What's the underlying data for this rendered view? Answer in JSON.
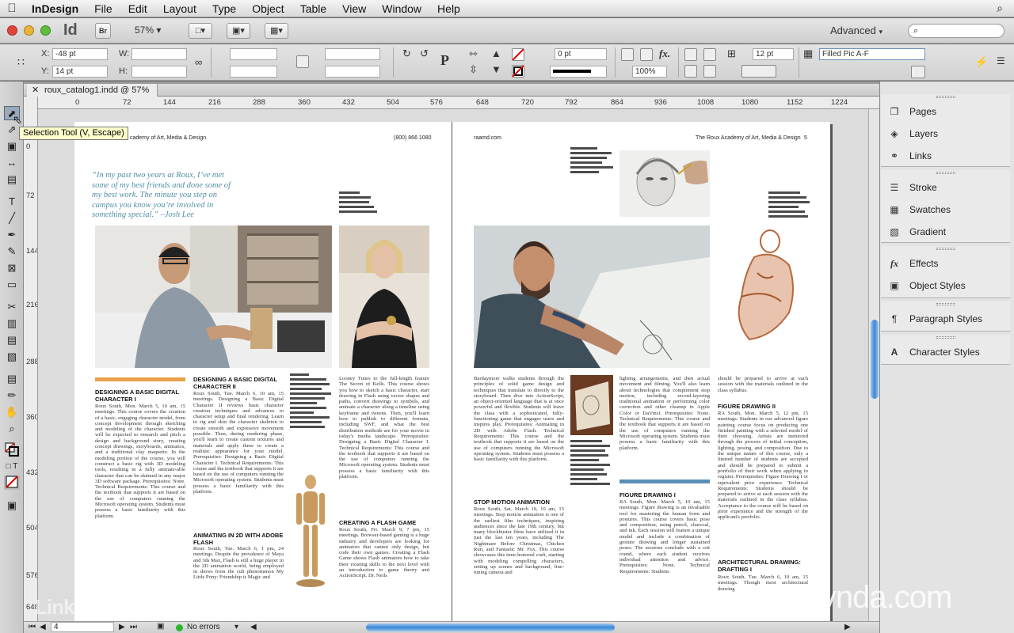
{
  "menubar": {
    "app": "InDesign",
    "items": [
      "File",
      "Edit",
      "Layout",
      "Type",
      "Object",
      "Table",
      "View",
      "Window",
      "Help"
    ]
  },
  "appbar": {
    "logo": "Id",
    "bridge": "Br",
    "zoom": "57%",
    "workspace": "Advanced"
  },
  "control": {
    "x_value": "-48 pt",
    "y_value": "14 pt",
    "stroke_weight": "0 pt",
    "opacity": "100%",
    "gap": "12 pt",
    "object_style": "Filled Pic A-F"
  },
  "tabs": {
    "doc_title": "roux_catalog1.indd @ 57%"
  },
  "tooltip": "Selection Tool (V, Escape)",
  "rulers": {
    "h": [
      "0",
      "72",
      "144",
      "216",
      "288",
      "360",
      "432",
      "504",
      "576",
      "648",
      "720",
      "792",
      "864",
      "936",
      "1008",
      "1080",
      "1152",
      "1224"
    ],
    "v": [
      "0",
      "72",
      "144",
      "216",
      "288",
      "360",
      "432",
      "504",
      "576",
      "648"
    ]
  },
  "spread": {
    "left_header": "cademy of Art, Media & Design",
    "left_phone": "(800) 866 1080",
    "right_url": "raamd.com",
    "right_header": "The Roux Academy of Art, Media & Design",
    "right_page_num": "5",
    "quote": "“In my past two years at Roux, I’ve met some of my best friends and done some of my best work. The minute you step on campus you know you’re involved in something special.” –Josh Lee",
    "course1_title": "DESIGNING A BASIC DIGITAL CHARACTER I",
    "course1_body": "Roux South, Mon. March 5, 10 am, 15 meetings. This course covers the creation of a basic, engaging character model, from concept development through sketching and modeling of the character. Students will be expected to research and pitch a design and background story, creating concept drawings, storyboards, animatics, and a traditional clay maquette. In the modeling portion of the course, you will construct a basic rig with 3D modeling tools, resulting in a fully animate-able character that can be skinned in any major 3D software package. Prerequisites: None. Technical Requirements: This course and the textbook that supports it are based on the use of computers running the Microsoft operating system. Students must possess a basic familiarity with this platform.",
    "course2_title": "DESIGNING A BASIC DIGITAL CHARACTER II",
    "course2_body": "Roux South, Tue. March 6, 10 am, 15 meetings. Designing a Basic Digital Character II reviews basic character creation techniques and advances to character setup and final rendering. Learn to rig and skin the character skeleton to create smooth and expressive movement possible. Then, during rendering phase, you'll learn to create custom textures and materials and apply these to create a realistic appearance for your model. Prerequisites: Designing a Basic Digital Character I. Technical Requirements: This course and the textbook that supports it are based on the use of computers running the Microsoft operating system. Students must possess a basic familiarity with this platform.",
    "course3_title": "ANIMATING IN 2D WITH ADOBE FLASH",
    "course3_body": "Roux South, Tue. March 6, 1 pm, 24 meetings. Despite the prevalence of Maya and 3ds Max, Flash is still a huge player in the 2D animation world, being employed in shows from the cult phenomenon My Little Pony: Friendship is Magic and",
    "col4_body": "Looney Tunes to the full-length feature The Secret of Kells. This course shows you how to sketch a basic character, start drawing in Flash using vector shapes and paths, convert drawings to symbols, and animate a character along a timeline using keyframe and tweens. Then, you'll learn how to publish to different formats, including SWF, and what the best distribution methods are for your movie in today's media landscape. Prerequisites: Designing a Basic Digital Character I. Technical Requirements: This course and the textbook that supports it are based on the use of computers running the Microsoft operating system. Students must possess a basic familiarity with this platform.",
    "course4_title": "CREATING A FLASH GAME",
    "course4_body": "Roux South, Fri. March 9, 7 pm, 15 meetings. Browser-based gaming is a huge industry and developers are looking for animators that cannot only design, but code their own games. Creating a Flash Game shows Flash animators how to take their existing skills to the next level with an introduction to game theory and ActionScript. Dr. Neils",
    "col5_body": "Bardaymore walks students through the principles of solid game design and techniques that translate to directly to the storyboard. Then dive into ActionScript, an object-oriented language that is at once powerful and flexible. Students will leave the class with a sophisticated, fully-functioning game that engages users and inspires play. Prerequisites: Animating in 2D with Adobe Flash. Technical Requirements: This course and the textbook that supports it are based on the use of computers running the Microsoft operating system. Students must possess a basic familiarity with this platform.",
    "course5_title": "STOP MOTION ANIMATION",
    "course5_body": "Roux South, Sat. March 10, 10 am, 15 meetings. Stop motion animation is one of the earliest film techniques, inspiring audiences since the late 19th century, but many blockbuster films have utilized it in just the last ten years, including The Nightmare Before Christmas, Chicken Run, and Fantastic Mr. Fox. This course showcases this time-honored craft, starting with modeling compelling characters, setting up scenes and background, fine-tuning camera and",
    "col6_body": "lighting arrangements, and then actual movement and filming. You'll also learn about technologies that complement stop motion, including record-layering traditional animation or performing color correction and other cleanup in Apple Color or DaVinci. Prerequisites: None. Technical Requirements: This course and the textbook that supports it are based on the use of computers running the Microsoft operating system. Students must possess a basic familiarity with this platform.",
    "course6_title": "FIGURE DRAWING I",
    "course6_body": "RA South, Mon. March 5, 10 am, 15 meetings. Figure drawing is an invaluable tool for mastering the human form and postures. This course covers basic pose and composition, using pencil, charcoal, and ink. Each session will feature a unique model and include a combination of gesture drawing and longer sustained poses. The sessions conclude with a crit round, where each student receives individual attention and advice. Prerequisites: None. Technical Requirements: Students",
    "col7_top": "should be prepared to arrive at each session with the materials outlined in the class syllabus.",
    "course7_title": "FIGURE DRAWING II",
    "course7_body": "RA South, Mon. March 5, 12 pm, 15 meetings. Students in our advanced figure painting course focus on producing one finished painting with a selected model of their choosing. Artists are mentored through the process of initial conception, lighting, posing, and composition. Due to the unique nature of this course, only a limited number of students are accepted and should be prepared to submit a portfolio of their work when applying to register. Prerequisites: Figure Drawing I or equivalent prior experience. Technical Requirements: Students should be prepared to arrive at each session with the materials outlined in the class syllabus. Acceptance to the course will be based on prior experience and the strength of the applicant's portfolio.",
    "course8_title": "ARCHITECTURAL DRAWING: DRAFTING I",
    "course8_body": "Roux South, Tue. March 6, 10 am, 15 meetings. Though most architectural drawing"
  },
  "status": {
    "page": "4",
    "errors": "No errors"
  },
  "panels": {
    "group1": [
      "Pages",
      "Layers",
      "Links"
    ],
    "group2": [
      "Stroke",
      "Swatches",
      "Gradient"
    ],
    "group3": [
      "Effects",
      "Object Styles"
    ],
    "group4": [
      "Paragraph Styles"
    ],
    "group5": [
      "Character Styles"
    ]
  },
  "watermarks": {
    "lynda": "lynda.com",
    "linkedin": "Linked in"
  },
  "colors": {
    "accent_orange": "#e8a04a",
    "accent_blue": "#5b8fb9",
    "quote_blue": "#4f8ea6",
    "scroll_blue": "#3d86d6"
  }
}
